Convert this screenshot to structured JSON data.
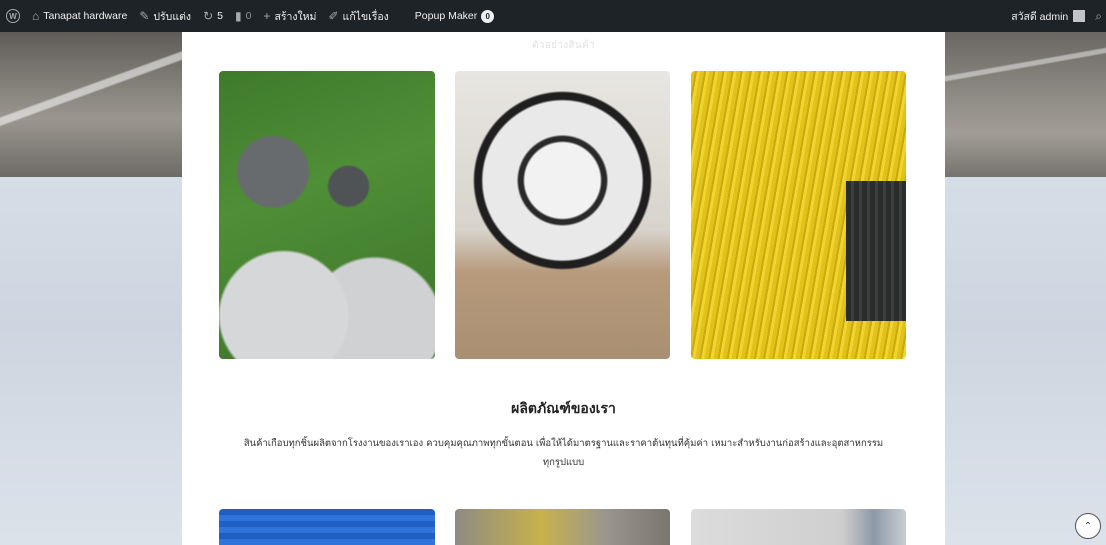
{
  "admin_bar": {
    "site_name": "Tanapat hardware",
    "customize_label": "ปรับแต่ง",
    "updates_count": "5",
    "comments_count": "0",
    "new_label": "สร้างใหม่",
    "edit_label": "แก้ไขเรื่อง",
    "popup_maker_label": "Popup Maker",
    "popup_maker_badge": "0",
    "greeting": "สวัสดี admin"
  },
  "main": {
    "faded_heading": "ตัวอย่างสินค้า",
    "gallery_top": [
      {
        "alt": "pipes-and-drains-photo"
      },
      {
        "alt": "cable-reel-photo"
      },
      {
        "alt": "yellow-pipes-photo"
      }
    ],
    "section_title": "ผลิตภัณฑ์ของเรา",
    "section_description": "สินค้าเกือบทุกชิ้นผลิตจากโรงงานของเราเอง ควบคุมคุณภาพทุกขั้นตอน เพื่อให้ได้มาตรฐานและราคาต้นทุนที่คุ้มค่า เหมาะสำหรับงานก่อสร้างและอุตสาหกรรมทุกรูปแบบ"
  },
  "icons": {
    "wordpress": "wordpress-logo-icon",
    "site": "home-icon",
    "customize": "brush-icon",
    "updates": "refresh-icon",
    "comments": "comment-icon",
    "new": "plus-icon",
    "edit": "pencil-icon",
    "search": "search-icon",
    "scroll_top": "chevron-up-icon"
  }
}
